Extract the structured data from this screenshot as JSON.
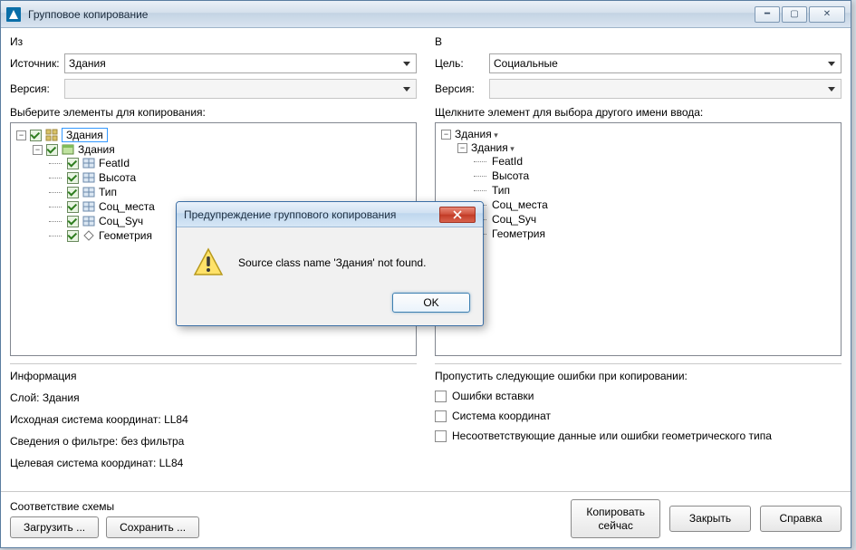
{
  "window": {
    "title": "Групповое копирование"
  },
  "sections": {
    "from": "Из",
    "to": "В"
  },
  "labels": {
    "source": "Источник:",
    "target": "Цель:",
    "version": "Версия:",
    "select_elems": "Выберите элементы для копирования:",
    "click_elem": "Щелкните элемент для выбора другого имени ввода:"
  },
  "dropdowns": {
    "source_value": "Здания",
    "target_value": "Социальные"
  },
  "tree_left": {
    "root": "Здания",
    "schema": "Здания",
    "fields": [
      "FeatId",
      "Высота",
      "Тип",
      "Соц_места",
      "Соц_Sуч",
      "Геометрия"
    ]
  },
  "tree_right": {
    "root": "Здания",
    "schema": "Здания",
    "fields": [
      "FeatId",
      "Высота",
      "Тип",
      "Соц_места",
      "Соц_Sуч",
      "Геометрия"
    ]
  },
  "info": {
    "header": "Информация",
    "layer": "Слой: Здания",
    "src_cs": "Исходная система координат: LL84",
    "filter": "Сведения о фильтре: без фильтра",
    "tgt_cs": "Целевая система координат: LL84"
  },
  "skip": {
    "header": "Пропустить следующие ошибки при копировании:",
    "insert": "Ошибки вставки",
    "cs": "Система координат",
    "geom": "Несоответствующие данные или ошибки геометрического типа"
  },
  "footer": {
    "schema_label": "Соответствие схемы",
    "load": "Загрузить ...",
    "save": "Сохранить ...",
    "copy_now": "Копировать\nсейчас",
    "copy_now_l1": "Копировать",
    "copy_now_l2": "сейчас",
    "close": "Закрыть",
    "help": "Справка"
  },
  "modal": {
    "title": "Предупреждение группового копирования",
    "message": "Source class name 'Здания' not found.",
    "ok": "OK"
  }
}
